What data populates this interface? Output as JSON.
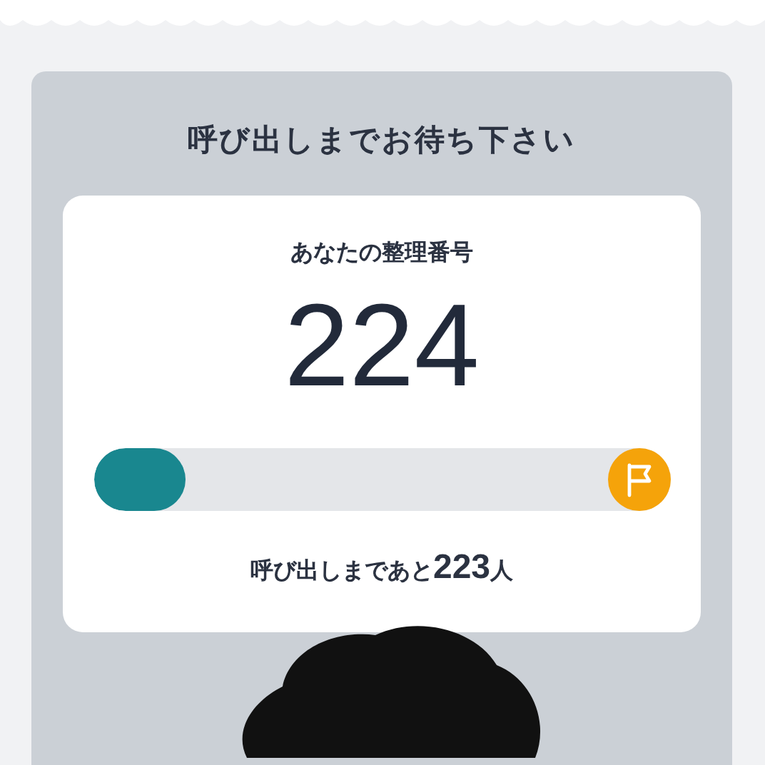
{
  "title": "呼び出しまでお待ち下さい",
  "ticket": {
    "label": "あなたの整理番号",
    "number": "224"
  },
  "progress": {
    "level": 0.16
  },
  "remaining": {
    "prefix": "呼び出しまであと",
    "count": "223",
    "suffix": "人"
  }
}
